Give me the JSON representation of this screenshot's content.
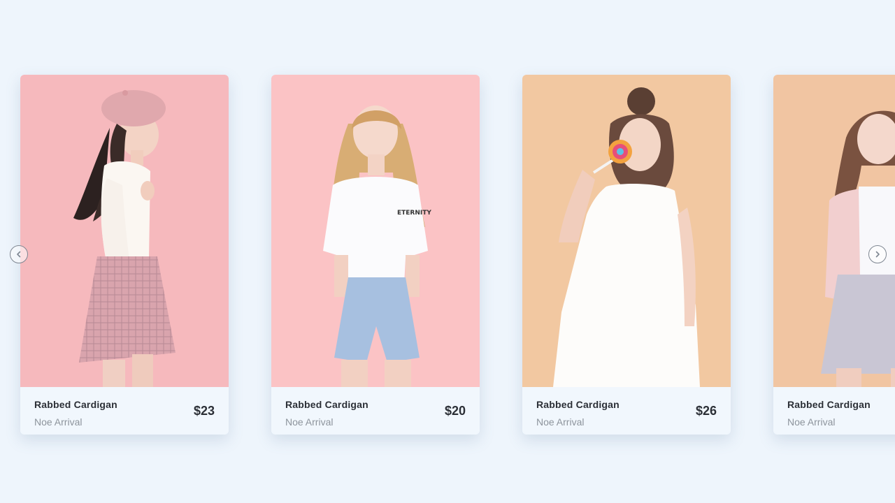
{
  "colors": {
    "background": "#eef5fc",
    "card_footer": "#f1f7fd",
    "text_dark": "#2b2f36",
    "text_muted": "#8d949c"
  },
  "carousel": {
    "prev_icon": "chevron-left-icon",
    "next_icon": "chevron-right-icon",
    "products": [
      {
        "name": "Rabbed Cardigan",
        "subtitle": "Noe Arrival",
        "price": "$23",
        "image_bg": "#f6b9bd"
      },
      {
        "name": "Rabbed Cardigan",
        "subtitle": "Noe Arrival",
        "price": "$20",
        "image_bg": "#fbc3c5",
        "shirt_text": "ETERNITY"
      },
      {
        "name": "Rabbed Cardigan",
        "subtitle": "Noe Arrival",
        "price": "$26",
        "image_bg": "#f2c8a1"
      },
      {
        "name": "Rabbed Cardigan",
        "subtitle": "Noe Arrival",
        "price": "",
        "image_bg": "#f1c5a2"
      }
    ]
  }
}
